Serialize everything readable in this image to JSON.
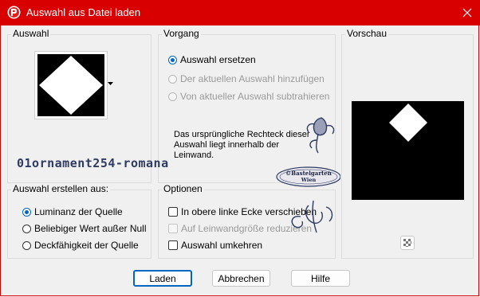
{
  "window": {
    "title": "Auswahl aus Datei laden",
    "titlebar_color": "#d80000"
  },
  "auswahl": {
    "label": "Auswahl",
    "dropdown_icon": "triangle-down-icon"
  },
  "vorgang": {
    "label": "Vorgang",
    "options": [
      {
        "label": "Auswahl ersetzen",
        "checked": true,
        "enabled": true
      },
      {
        "label": "Der aktuellen Auswahl hinzufügen",
        "checked": false,
        "enabled": false
      },
      {
        "label": "Von aktueller Auswahl subtrahieren",
        "checked": false,
        "enabled": false
      }
    ],
    "info_lines": [
      "Das ursprüngliche Rechteck dieser",
      "Auswahl liegt innerhalb der",
      "Leinwand."
    ]
  },
  "vorschau": {
    "label": "Vorschau",
    "checker_icon": "checkerboard-icon"
  },
  "erstellen": {
    "label": "Auswahl erstellen aus:",
    "options": [
      {
        "label": "Luminanz der Quelle",
        "checked": true
      },
      {
        "label": "Beliebiger Wert außer Null",
        "checked": false
      },
      {
        "label": "Deckfähigkeit der Quelle",
        "checked": false
      }
    ]
  },
  "optionen": {
    "label": "Optionen",
    "checks": [
      {
        "label": "In obere linke Ecke verschieben",
        "checked": false,
        "enabled": true
      },
      {
        "label": "Auf Leinwandgröße reduzieren",
        "checked": false,
        "enabled": false
      },
      {
        "label": "Auswahl umkehren",
        "checked": false,
        "enabled": true
      }
    ]
  },
  "watermark": {
    "name": "01ornament254-romana",
    "stamp_line1": "©Bastelgarten",
    "stamp_line2": "Wien"
  },
  "buttons": {
    "load": "Laden",
    "cancel": "Abbrechen",
    "help": "Hilfe"
  },
  "colors": {
    "accent": "#0067c0",
    "disabled_text": "#9a9a9a"
  }
}
